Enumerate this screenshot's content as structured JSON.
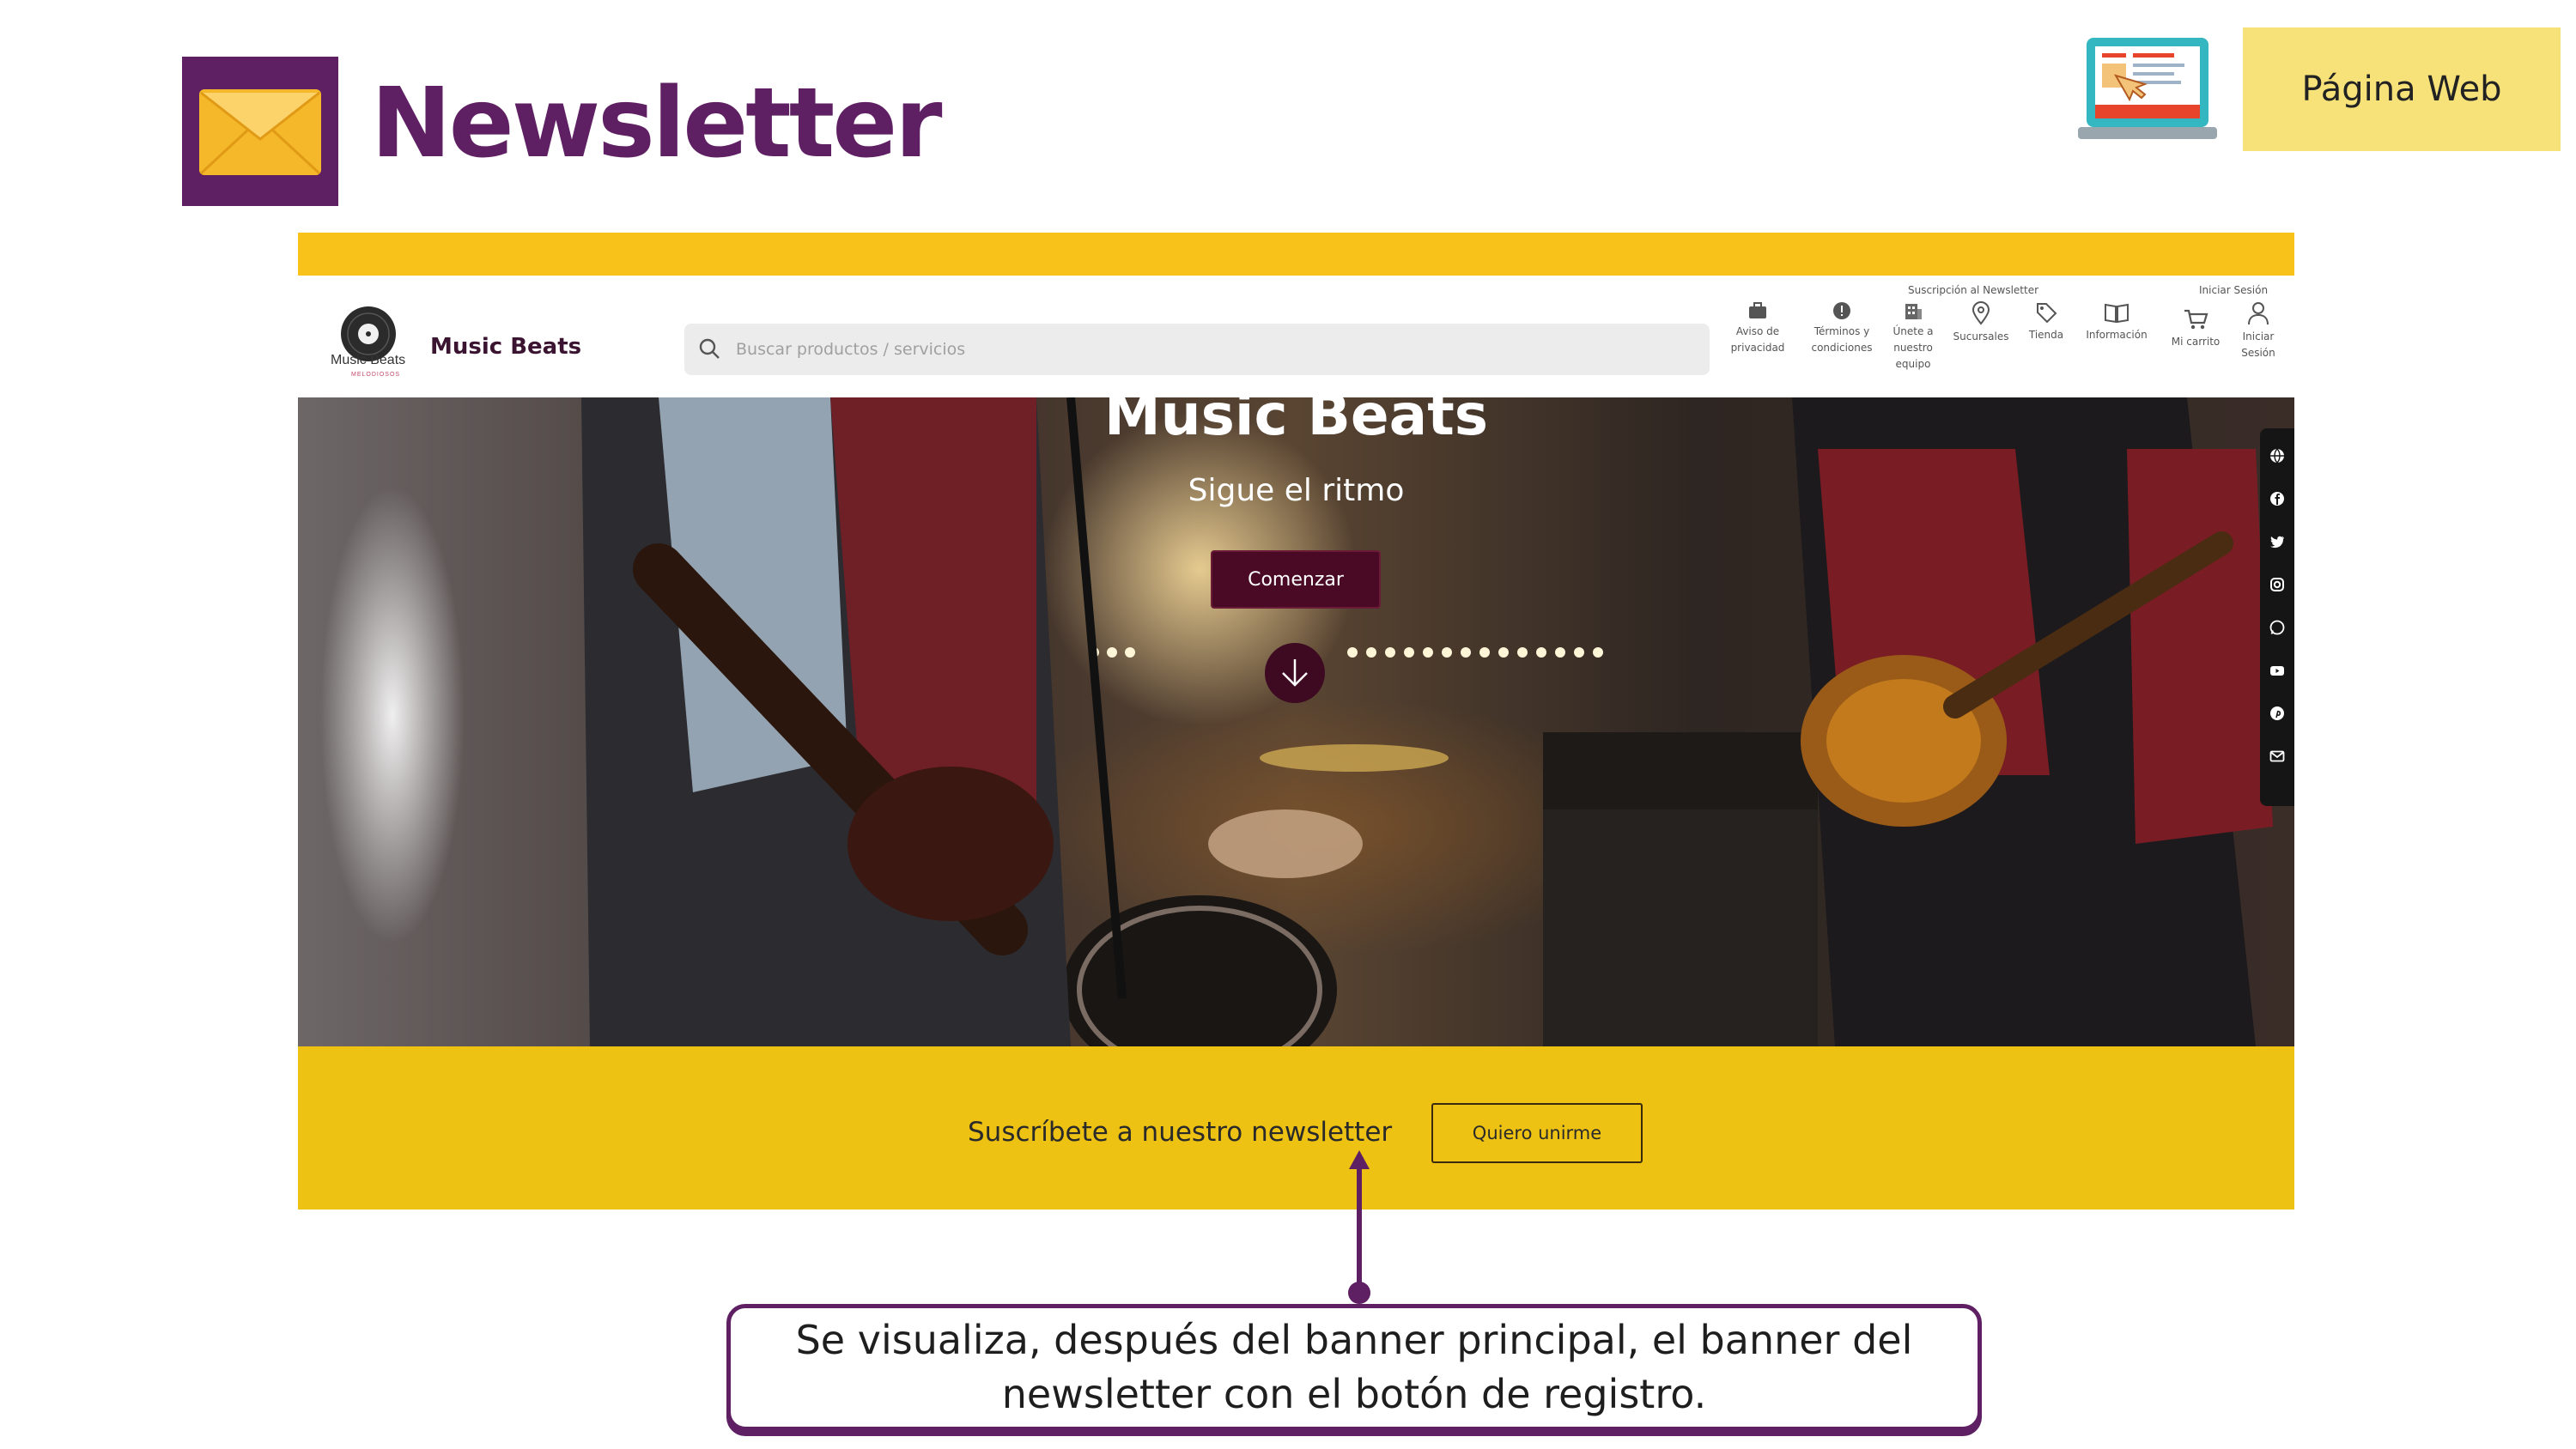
{
  "slide": {
    "title": "Newsletter",
    "section_tag": "Página Web",
    "colors": {
      "brand_purple": "#5e1f63",
      "tag_yellow": "#f7e27a",
      "band_yellow": "#edc213",
      "stripe_yellow": "#f8c21a"
    },
    "title_icon": "envelope-icon",
    "corner_icon": "laptop-web-icon"
  },
  "website": {
    "logo": {
      "text": "Music Beats",
      "sub": "MELODIOSOS"
    },
    "brand_name": "Music Beats",
    "search_placeholder": "Buscar productos / servicios",
    "top_links": {
      "newsletter": "Suscripción al Newsletter",
      "login": "Iniciar Sesión"
    },
    "nav": [
      {
        "icon": "briefcase-icon",
        "label": "Aviso de privacidad"
      },
      {
        "icon": "info-icon",
        "label": "Términos y condiciones"
      },
      {
        "icon": "building-icon",
        "label": "Únete a nuestro equipo"
      },
      {
        "icon": "map-pin-icon",
        "label": "Sucursales"
      },
      {
        "icon": "tag-icon",
        "label": "Tienda"
      },
      {
        "icon": "book-icon",
        "label": "Información"
      },
      {
        "icon": "cart-icon",
        "label": "Mi carrito"
      },
      {
        "icon": "user-icon",
        "label": "Iniciar Sesión"
      }
    ],
    "hero": {
      "title": "Music Beats",
      "subtitle": "Sigue el ritmo",
      "cta": "Comenzar",
      "scroll_icon": "arrow-down-circle-icon"
    },
    "social": [
      "globe-icon",
      "facebook-icon",
      "twitter-icon",
      "instagram-icon",
      "whatsapp-icon",
      "youtube-icon",
      "pinterest-icon",
      "mail-icon"
    ],
    "newsletter": {
      "text": "Suscríbete a nuestro newsletter",
      "button": "Quiero unirme"
    }
  },
  "annotation": {
    "text": "Se visualiza, después del banner principal, el banner del newsletter con el botón de registro."
  }
}
